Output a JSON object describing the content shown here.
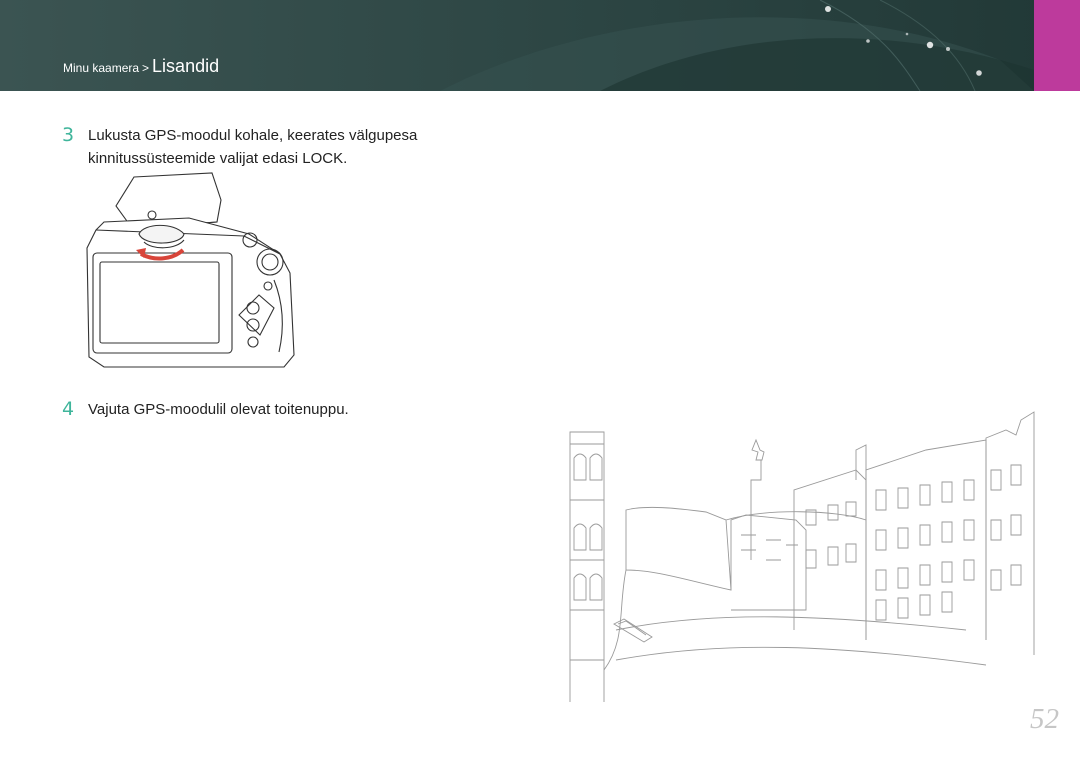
{
  "header": {
    "breadcrumb_parent": "Minu kaamera",
    "breadcrumb_separator": ">",
    "breadcrumb_current": "Lisandid",
    "accent_color": "#bd3a9c",
    "background_color": "#2c4543"
  },
  "steps": [
    {
      "number": "3",
      "lines": [
        "Lukusta GPS-moodul kohale, keerates välgupesa",
        "kinnitussüsteemide valijat edasi LOCK."
      ]
    },
    {
      "number": "4",
      "lines": [
        "Vajuta GPS-moodulil olevat toitenuppu."
      ]
    }
  ],
  "illustrations": {
    "camera": "camera-gps-module-icon",
    "city": "city-canal-sketch-icon"
  },
  "page_number": "52"
}
